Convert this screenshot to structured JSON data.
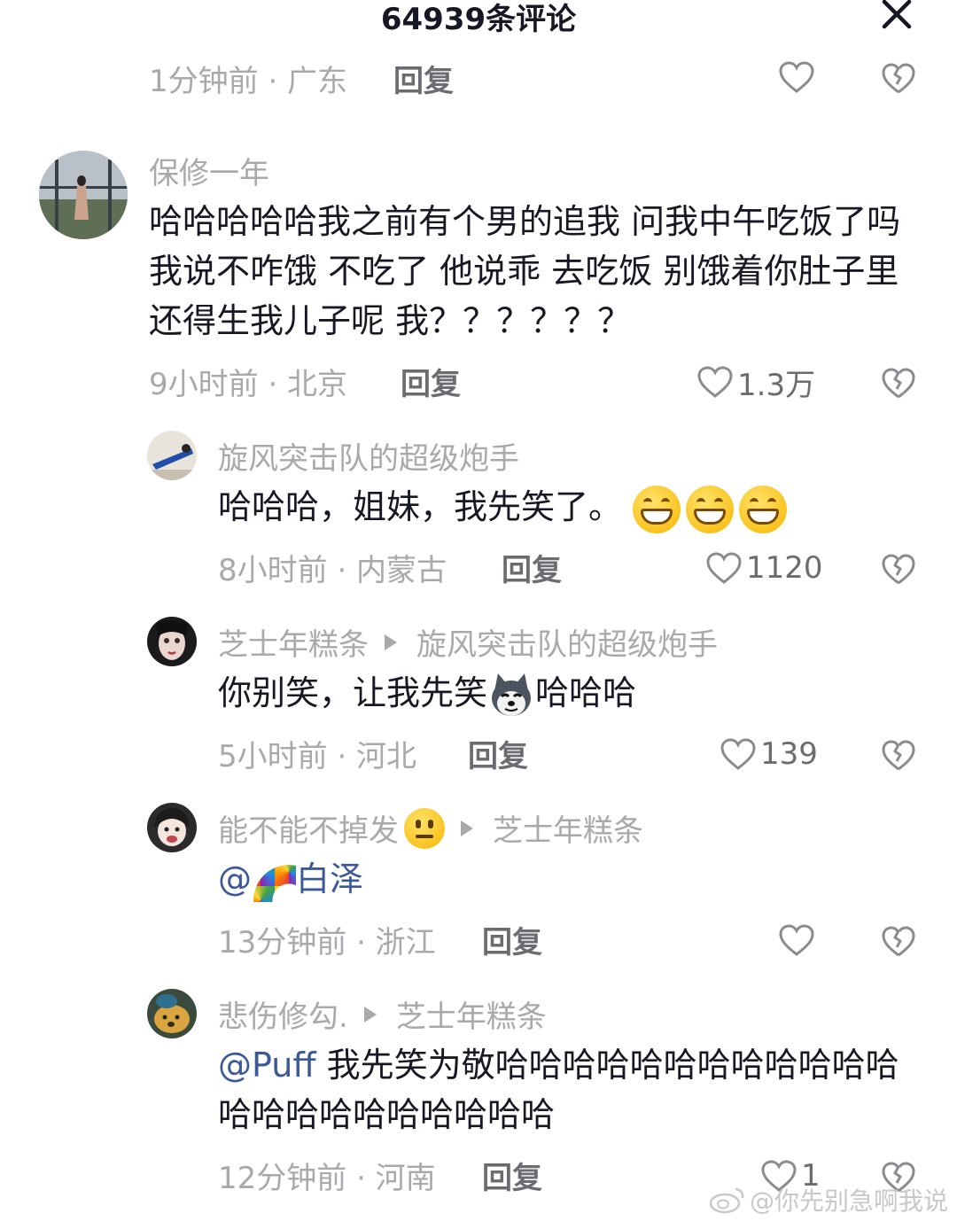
{
  "header": {
    "title": "64939条评论"
  },
  "top_comment_meta": {
    "time_location": "1分钟前 · 广东",
    "reply_label": "回复"
  },
  "comments": [
    {
      "username": "保修一年",
      "text": "哈哈哈哈哈我之前有个男的追我 问我中午吃饭了吗 我说不咋饿 不吃了 他说乖 去吃饭 别饿着你肚子里还得生我儿子呢 我？？？？？？",
      "time_location": "9小时前 · 北京",
      "reply_label": "回复",
      "likes": "1.3万"
    },
    {
      "username": "旋风突击队的超级炮手",
      "text": "哈哈哈，姐妹，我先笑了。",
      "emojis": [
        "grinning-face",
        "grinning-face",
        "grinning-face"
      ],
      "time_location": "8小时前 · 内蒙古",
      "reply_label": "回复",
      "likes": "1120"
    },
    {
      "username": "芝士年糕条",
      "reply_to": "旋风突击队的超级炮手",
      "text_before": "你别笑，让我先笑",
      "emoji": "husky-dog",
      "text_after": "哈哈哈",
      "time_location": "5小时前 · 河北",
      "reply_label": "回复",
      "likes": "139"
    },
    {
      "username": "能不能不掉发",
      "username_emoji": "neutral-face",
      "reply_to": "芝士年糕条",
      "mention_prefix": "@",
      "mention_emoji": "rainbow",
      "mention_name": "白泽",
      "time_location": "13分钟前 · 浙江",
      "reply_label": "回复",
      "likes": ""
    },
    {
      "username": "悲伤修勾.",
      "reply_to": "芝士年糕条",
      "mention": "@Puff",
      "text": " 我先笑为敬哈哈哈哈哈哈哈哈哈哈哈哈哈哈哈哈哈哈哈哈哈哈",
      "time_location": "12分钟前 · 河南",
      "reply_label": "回复",
      "likes": "1"
    }
  ],
  "watermark": {
    "text": "@你先别急啊我说"
  },
  "colors": {
    "text_primary": "#161823",
    "text_secondary": "#a8a9ad",
    "mention": "#3b5998",
    "background": "#ffffff"
  }
}
